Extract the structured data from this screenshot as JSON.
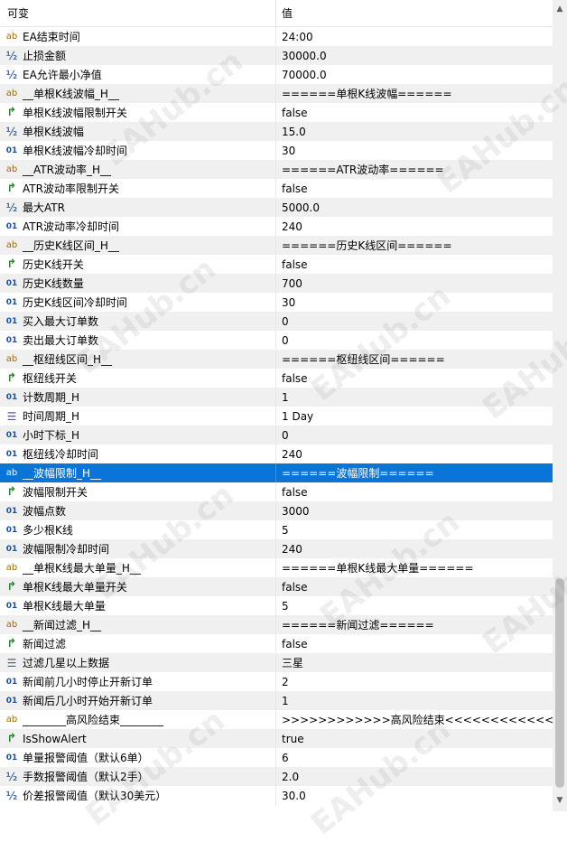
{
  "header": {
    "name_col": "可变",
    "value_col": "值"
  },
  "rows": [
    {
      "icon": "ab",
      "name": "EA结束时间",
      "value": "24:00"
    },
    {
      "icon": "half",
      "name": "止损金额",
      "value": "30000.0"
    },
    {
      "icon": "half",
      "name": "EA允许最小净值",
      "value": "70000.0"
    },
    {
      "icon": "ab",
      "name": "__单根K线波幅_H__",
      "value": "======单根K线波幅======"
    },
    {
      "icon": "bool",
      "name": "单根K线波幅限制开关",
      "value": "false"
    },
    {
      "icon": "half",
      "name": "单根K线波幅",
      "value": "15.0"
    },
    {
      "icon": "01",
      "name": "单根K线波幅冷却时间",
      "value": "30"
    },
    {
      "icon": "ab",
      "name": "__ATR波动率_H__",
      "value": "======ATR波动率======"
    },
    {
      "icon": "bool",
      "name": "ATR波动率限制开关",
      "value": "false"
    },
    {
      "icon": "half",
      "name": "最大ATR",
      "value": "5000.0"
    },
    {
      "icon": "01",
      "name": "ATR波动率冷却时间",
      "value": "240"
    },
    {
      "icon": "ab",
      "name": "__历史K线区间_H__",
      "value": "======历史K线区间======"
    },
    {
      "icon": "bool",
      "name": "历史K线开关",
      "value": "false"
    },
    {
      "icon": "01",
      "name": "历史K线数量",
      "value": "700"
    },
    {
      "icon": "01",
      "name": "历史K线区间冷却时间",
      "value": "30"
    },
    {
      "icon": "01",
      "name": "买入最大订单数",
      "value": "0"
    },
    {
      "icon": "01",
      "name": "卖出最大订单数",
      "value": "0"
    },
    {
      "icon": "ab",
      "name": "__枢纽线区间_H__",
      "value": "======枢纽线区间======"
    },
    {
      "icon": "bool",
      "name": "枢纽线开关",
      "value": "false"
    },
    {
      "icon": "01",
      "name": "计数周期_H",
      "value": "1"
    },
    {
      "icon": "enum",
      "name": "时间周期_H",
      "value": "1 Day"
    },
    {
      "icon": "01",
      "name": "小时下标_H",
      "value": "0"
    },
    {
      "icon": "01",
      "name": "枢纽线冷却时间",
      "value": "240"
    },
    {
      "icon": "ab",
      "name": "__波幅限制_H__",
      "value": "======波幅限制======",
      "selected": true
    },
    {
      "icon": "bool",
      "name": "波幅限制开关",
      "value": "false"
    },
    {
      "icon": "01",
      "name": "波幅点数",
      "value": "3000"
    },
    {
      "icon": "01",
      "name": "多少根K线",
      "value": "5"
    },
    {
      "icon": "01",
      "name": "波幅限制冷却时间",
      "value": "240"
    },
    {
      "icon": "ab",
      "name": "__单根K线最大单量_H__",
      "value": "======单根K线最大单量======"
    },
    {
      "icon": "bool",
      "name": "单根K线最大单量开关",
      "value": "false"
    },
    {
      "icon": "01",
      "name": "单根K线最大单量",
      "value": "5"
    },
    {
      "icon": "ab",
      "name": "__新闻过滤_H__",
      "value": "======新闻过滤======"
    },
    {
      "icon": "bool",
      "name": "新闻过滤",
      "value": "false"
    },
    {
      "icon": "enum",
      "name": "过滤几星以上数据",
      "value": "三星"
    },
    {
      "icon": "01",
      "name": "新闻前几小时停止开新订单",
      "value": "2"
    },
    {
      "icon": "01",
      "name": "新闻后几小时开始开新订单",
      "value": "1"
    },
    {
      "icon": "ab",
      "name": "________高风险结束________",
      "value": ">>>>>>>>>>>>高风险结束<<<<<<<<<<<<"
    },
    {
      "icon": "bool",
      "name": "IsShowAlert",
      "value": "true"
    },
    {
      "icon": "01",
      "name": "单量报警阈值（默认6单）",
      "value": "6"
    },
    {
      "icon": "half",
      "name": "手数报警阈值（默认2手）",
      "value": "2.0"
    },
    {
      "icon": "half",
      "name": "价差报警阈值（默认30美元）",
      "value": "30.0"
    }
  ],
  "icon_glyphs": {
    "ab": "ab",
    "half": "½",
    "01": "01",
    "bool": "↱",
    "enum": "☰"
  },
  "watermark": "EAHub.cn",
  "colors": {
    "selected_row": "#0a74d8",
    "alt_row": "#f0f0f0"
  }
}
